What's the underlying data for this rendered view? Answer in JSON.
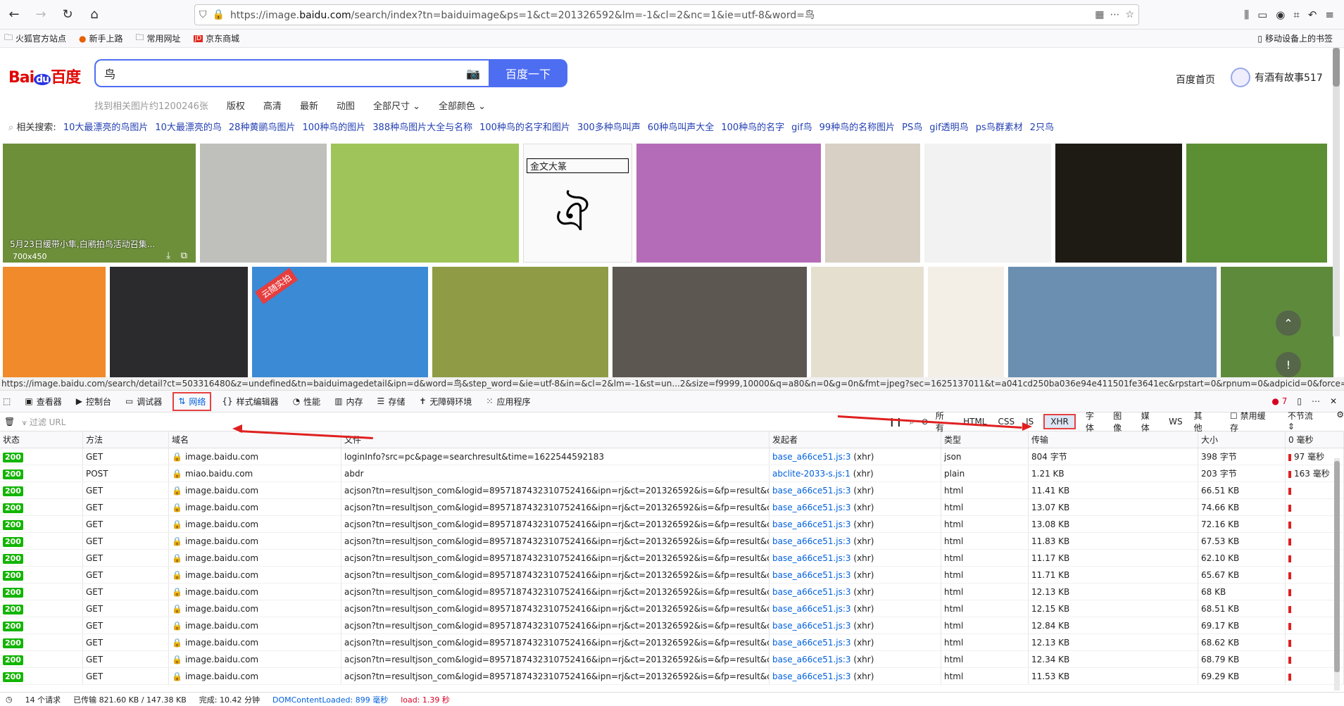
{
  "browser": {
    "url_prefix": "https://image.",
    "url_domain": "baidu.com",
    "url_rest": "/search/index?tn=baiduimage&ps=1&ct=201326592&lm=-1&cl=2&nc=1&ie=utf-8&word=鸟",
    "bookmarks": [
      "火狐官方站点",
      "新手上路",
      "常用网址",
      "京东商城"
    ],
    "mobile_bookmarks": "移动设备上的书签"
  },
  "baidu": {
    "logo_bai": "Bai",
    "logo_du": "du",
    "logo_text": "百度",
    "query": "鸟",
    "search_button": "百度一下",
    "home_link": "百度首页",
    "username": "有酒有故事517",
    "result_count": "找到相关图片约1200246张",
    "filters": [
      "版权",
      "高清",
      "最新",
      "动图",
      "全部尺寸",
      "全部颜色"
    ],
    "related_label": "相关搜索:",
    "related": [
      "10大最漂亮的鸟图片",
      "10大最漂亮的鸟",
      "28种黄鹂鸟图片",
      "100种鸟的图片",
      "388种鸟图片大全与名称",
      "100种鸟的名字和图片",
      "300多种鸟叫声",
      "60种鸟叫声大全",
      "100种鸟的名字",
      "gif鸟",
      "99种鸟的名称图片",
      "PS鸟",
      "gif透明鸟",
      "ps鸟群素材",
      "2只鸟"
    ],
    "tile_caption": "5月23日缓带小隼,白鹇拍鸟活动召集...",
    "tile_size": "700x450",
    "tile_badge": "云随实拍",
    "tile_jinwen": "金文大篆",
    "status_url": "https://image.baidu.com/search/detail?ct=503316480&z=undefined&tn=baiduimagedetail&ipn=d&word=鸟&step_word=&ie=utf-8&in=&cl=2&lm=-1&st=un...2&size=f9999,10000&q=a80&n=0&g=0n&fmt=jpeg?sec=1625137011&t=a041cd250ba036e94e411501fe3641ec&rpstart=0&rpnum=0&adpicid=0&force=undefined"
  },
  "devtools": {
    "tabs": [
      "查看器",
      "控制台",
      "调试器",
      "网络",
      "样式编辑器",
      "性能",
      "内存",
      "存储",
      "无障碍环境",
      "应用程序"
    ],
    "error_count": "7",
    "filter_placeholder": "过滤 URL",
    "type_filters": [
      "所有",
      "HTML",
      "CSS",
      "JS",
      "XHR",
      "字体",
      "图像",
      "媒体",
      "WS",
      "其他"
    ],
    "disable_cache": "禁用缓存",
    "throttle": "不节流",
    "columns": [
      "状态",
      "方法",
      "域名",
      "文件",
      "发起者",
      "类型",
      "传输",
      "大小",
      "0 毫秒"
    ],
    "rows": [
      {
        "status": "200",
        "method": "GET",
        "domain": "image.baidu.com",
        "file": "loginInfo?src=pc&page=searchresult&time=1622544592183",
        "initiator": "base_a66ce51.js:3",
        "init_type": "(xhr)",
        "type": "json",
        "transfer": "804 字节",
        "size": "398 字节",
        "time": "97 毫秒"
      },
      {
        "status": "200",
        "method": "POST",
        "domain": "miao.baidu.com",
        "file": "abdr",
        "initiator": "abclite-2033-s.js:1",
        "init_type": "(xhr)",
        "type": "plain",
        "transfer": "1.21 KB",
        "size": "203 字节",
        "time": "163 毫秒"
      },
      {
        "status": "200",
        "method": "GET",
        "domain": "image.baidu.com",
        "file": "acjson?tn=resultjson_com&logid=8957187432310752416&ipn=rj&ct=201326592&is=&fp=result&queryWord=鸟",
        "initiator": "base_a66ce51.js:3",
        "init_type": "(xhr)",
        "type": "html",
        "transfer": "11.41 KB",
        "size": "66.51 KB",
        "time": ""
      },
      {
        "status": "200",
        "method": "GET",
        "domain": "image.baidu.com",
        "file": "acjson?tn=resultjson_com&logid=8957187432310752416&ipn=rj&ct=201326592&is=&fp=result&queryWord=鸟",
        "initiator": "base_a66ce51.js:3",
        "init_type": "(xhr)",
        "type": "html",
        "transfer": "13.07 KB",
        "size": "74.66 KB",
        "time": ""
      },
      {
        "status": "200",
        "method": "GET",
        "domain": "image.baidu.com",
        "file": "acjson?tn=resultjson_com&logid=8957187432310752416&ipn=rj&ct=201326592&is=&fp=result&queryWord=鸟",
        "initiator": "base_a66ce51.js:3",
        "init_type": "(xhr)",
        "type": "html",
        "transfer": "13.08 KB",
        "size": "72.16 KB",
        "time": ""
      },
      {
        "status": "200",
        "method": "GET",
        "domain": "image.baidu.com",
        "file": "acjson?tn=resultjson_com&logid=8957187432310752416&ipn=rj&ct=201326592&is=&fp=result&queryWord=鸟",
        "initiator": "base_a66ce51.js:3",
        "init_type": "(xhr)",
        "type": "html",
        "transfer": "11.83 KB",
        "size": "67.53 KB",
        "time": ""
      },
      {
        "status": "200",
        "method": "GET",
        "domain": "image.baidu.com",
        "file": "acjson?tn=resultjson_com&logid=8957187432310752416&ipn=rj&ct=201326592&is=&fp=result&queryWord=鸟",
        "initiator": "base_a66ce51.js:3",
        "init_type": "(xhr)",
        "type": "html",
        "transfer": "11.17 KB",
        "size": "62.10 KB",
        "time": ""
      },
      {
        "status": "200",
        "method": "GET",
        "domain": "image.baidu.com",
        "file": "acjson?tn=resultjson_com&logid=8957187432310752416&ipn=rj&ct=201326592&is=&fp=result&queryWord=鸟",
        "initiator": "base_a66ce51.js:3",
        "init_type": "(xhr)",
        "type": "html",
        "transfer": "11.71 KB",
        "size": "65.67 KB",
        "time": ""
      },
      {
        "status": "200",
        "method": "GET",
        "domain": "image.baidu.com",
        "file": "acjson?tn=resultjson_com&logid=8957187432310752416&ipn=rj&ct=201326592&is=&fp=result&queryWord=鸟",
        "initiator": "base_a66ce51.js:3",
        "init_type": "(xhr)",
        "type": "html",
        "transfer": "12.13 KB",
        "size": "68 KB",
        "time": ""
      },
      {
        "status": "200",
        "method": "GET",
        "domain": "image.baidu.com",
        "file": "acjson?tn=resultjson_com&logid=8957187432310752416&ipn=rj&ct=201326592&is=&fp=result&queryWord=鸟",
        "initiator": "base_a66ce51.js:3",
        "init_type": "(xhr)",
        "type": "html",
        "transfer": "12.15 KB",
        "size": "68.51 KB",
        "time": ""
      },
      {
        "status": "200",
        "method": "GET",
        "domain": "image.baidu.com",
        "file": "acjson?tn=resultjson_com&logid=8957187432310752416&ipn=rj&ct=201326592&is=&fp=result&queryWord=鸟",
        "initiator": "base_a66ce51.js:3",
        "init_type": "(xhr)",
        "type": "html",
        "transfer": "12.84 KB",
        "size": "69.17 KB",
        "time": ""
      },
      {
        "status": "200",
        "method": "GET",
        "domain": "image.baidu.com",
        "file": "acjson?tn=resultjson_com&logid=8957187432310752416&ipn=rj&ct=201326592&is=&fp=result&queryWord=鸟",
        "initiator": "base_a66ce51.js:3",
        "init_type": "(xhr)",
        "type": "html",
        "transfer": "12.13 KB",
        "size": "68.62 KB",
        "time": ""
      },
      {
        "status": "200",
        "method": "GET",
        "domain": "image.baidu.com",
        "file": "acjson?tn=resultjson_com&logid=8957187432310752416&ipn=rj&ct=201326592&is=&fp=result&queryWord=鸟",
        "initiator": "base_a66ce51.js:3",
        "init_type": "(xhr)",
        "type": "html",
        "transfer": "12.34 KB",
        "size": "68.79 KB",
        "time": ""
      },
      {
        "status": "200",
        "method": "GET",
        "domain": "image.baidu.com",
        "file": "acjson?tn=resultjson_com&logid=8957187432310752416&ipn=rj&ct=201326592&is=&fp=result&queryWord=鸟",
        "initiator": "base_a66ce51.js:3",
        "init_type": "(xhr)",
        "type": "html",
        "transfer": "11.53 KB",
        "size": "69.29 KB",
        "time": ""
      }
    ],
    "status_requests": "14 个请求",
    "status_transferred": "已传输 821.60 KB / 147.38 KB",
    "status_finish": "完成: 10.42 分钟",
    "status_dom": "DOMContentLoaded: 899 毫秒",
    "status_load": "load: 1.39 秒"
  },
  "colors": {
    "accent": "#4e6ef2",
    "status_ok": "#12b500",
    "highlight": "#e54040",
    "link": "#0060df"
  },
  "tiles": [
    {
      "c": "#6d8f3a",
      "icon": "yellow-bird"
    },
    {
      "c": "#bfbfbb",
      "icon": "illustration"
    },
    {
      "c": "#9fc45a",
      "icon": "bird-on-grass"
    },
    {
      "c": "#fafafa",
      "icon": "calligraphy"
    },
    {
      "c": "#b56cb8",
      "icon": "blackbird"
    },
    {
      "c": "#d8d0c4",
      "icon": "porcelain-cup"
    },
    {
      "c": "#f2f2f2",
      "icon": "lego-birds"
    },
    {
      "c": "#1e1a14",
      "icon": "driftwood"
    },
    {
      "c": "#5c8f34",
      "icon": "paradise-flycatcher"
    },
    {
      "c": "#f08a2b",
      "icon": "orange-fabric"
    },
    {
      "c": "#2b2b2e",
      "icon": "girls-photo"
    },
    {
      "c": "#3a8ad6",
      "icon": "birdcage"
    },
    {
      "c": "#8f9c45",
      "icon": "lark"
    },
    {
      "c": "#5c5750",
      "icon": "lizard"
    },
    {
      "c": "#e5dfcf",
      "icon": "ancient-glyph"
    },
    {
      "c": "#f4efe6",
      "icon": "bird-chart"
    },
    {
      "c": "#6a8fb0",
      "icon": "waxwing"
    },
    {
      "c": "#5e8a3c",
      "icon": "hummingbird"
    }
  ]
}
